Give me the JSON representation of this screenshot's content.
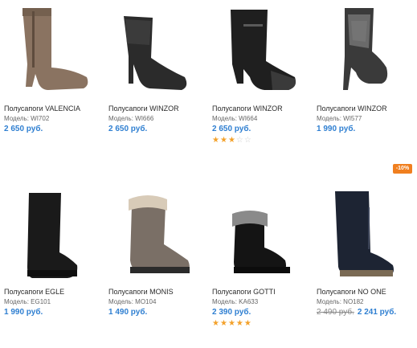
{
  "products": [
    {
      "title": "Полусапоги VALENCIA",
      "model": "Модель: WI702",
      "price": "2 650 руб."
    },
    {
      "title": "Полусапоги WINZOR",
      "model": "Модель: WI666",
      "price": "2 650 руб."
    },
    {
      "title": "Полусапоги WINZOR",
      "model": "Модель: WI664",
      "price": "2 650 руб.",
      "rating": 3,
      "rating_max": 5
    },
    {
      "title": "Полусапоги WINZOR",
      "model": "Модель: WI577",
      "price": "1 990 руб."
    },
    {
      "title": "Полусапоги EGLE",
      "model": "Модель: EG101",
      "price": "1 990 руб."
    },
    {
      "title": "Полусапоги MONIS",
      "model": "Модель: MO104",
      "price": "1 490 руб."
    },
    {
      "title": "Полусапоги GOTTI",
      "model": "Модель: KA633",
      "price": "2 390 руб.",
      "rating": 5,
      "rating_max": 5
    },
    {
      "title": "Полусапоги NO ONE",
      "model": "Модель: NO182",
      "old_price": "2 490 руб.",
      "price": "2 241 руб.",
      "discount_badge": "-10%"
    }
  ],
  "colors": {
    "price": "#2f7fd1",
    "star": "#f3a12a",
    "star_off": "#cfcfcf",
    "badge": "#f07f1f"
  }
}
